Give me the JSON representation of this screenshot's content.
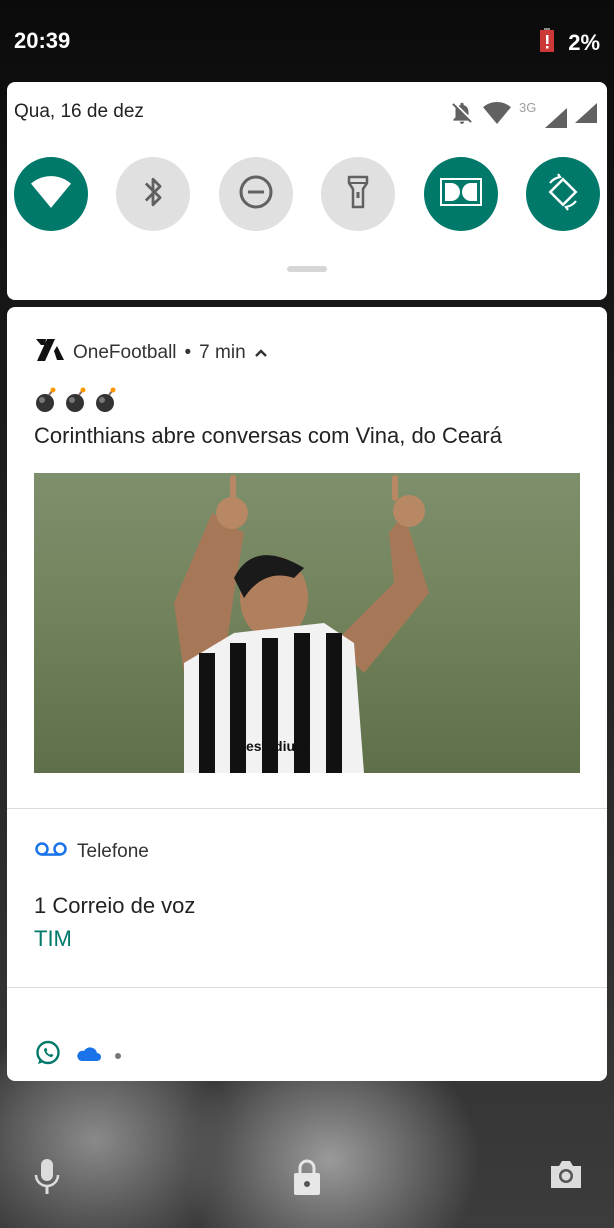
{
  "status_bar": {
    "time": "20:39",
    "battery_level": "2%",
    "battery_icon": "battery-alert-icon",
    "battery_color": "#d32f2f"
  },
  "quick_settings": {
    "date": "Qua, 16 de dez",
    "network_label": "3G",
    "system_icons": [
      "notifications-off-icon",
      "wifi-icon",
      "cell-signal-icon",
      "cell-signal-icon"
    ],
    "tiles": [
      {
        "icon": "wifi-icon",
        "active": true
      },
      {
        "icon": "bluetooth-icon",
        "active": false
      },
      {
        "icon": "do-not-disturb-icon",
        "active": false
      },
      {
        "icon": "flashlight-icon",
        "active": false
      },
      {
        "icon": "dolby-icon",
        "active": true
      },
      {
        "icon": "auto-rotate-icon",
        "active": true
      }
    ],
    "accent_color": "#00796b"
  },
  "notifications": {
    "onefootball": {
      "app_name": "OneFootball",
      "separator": "•",
      "time": "7 min",
      "emojis": [
        "bomb-emoji",
        "bomb-emoji",
        "bomb-emoji"
      ],
      "headline": "Corinthians abre conversas com Vina, do Ceará",
      "image_caption_text": "estadium"
    },
    "telefone": {
      "app_name": "Telefone",
      "title": "1 Correio de voz",
      "subtitle": "TIM"
    },
    "minimized_icons": [
      "whatsapp-icon",
      "onedrive-icon"
    ]
  },
  "lockscreen_shortcuts": [
    "microphone-icon",
    "lock-icon",
    "camera-icon"
  ]
}
